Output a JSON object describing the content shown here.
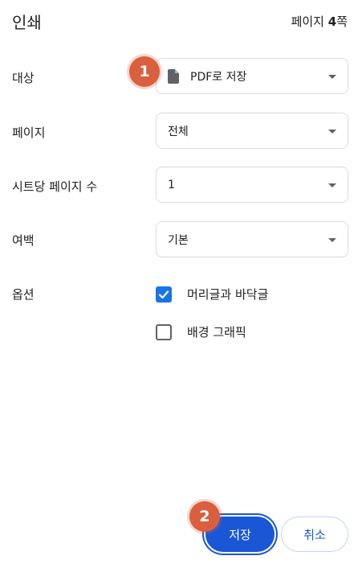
{
  "header": {
    "title": "인쇄",
    "page_count_prefix": "페이지 ",
    "page_count_value": "4",
    "page_count_suffix": "쪽"
  },
  "destination": {
    "label": "대상",
    "value": "PDF로 저장",
    "icon": "document-icon"
  },
  "pages": {
    "label": "페이지",
    "value": "전체"
  },
  "pages_per_sheet": {
    "label": "시트당 페이지 수",
    "value": "1"
  },
  "margins": {
    "label": "여백",
    "value": "기본"
  },
  "options": {
    "label": "옵션",
    "items": [
      {
        "label": "머리글과 바닥글",
        "checked": true
      },
      {
        "label": "배경 그래픽",
        "checked": false
      }
    ]
  },
  "buttons": {
    "save": "저장",
    "cancel": "취소"
  },
  "markers": {
    "first": "1",
    "second": "2"
  },
  "colors": {
    "accent": "#1a73e8",
    "primary_button": "#1a57d6",
    "marker": "#d95f3e"
  }
}
